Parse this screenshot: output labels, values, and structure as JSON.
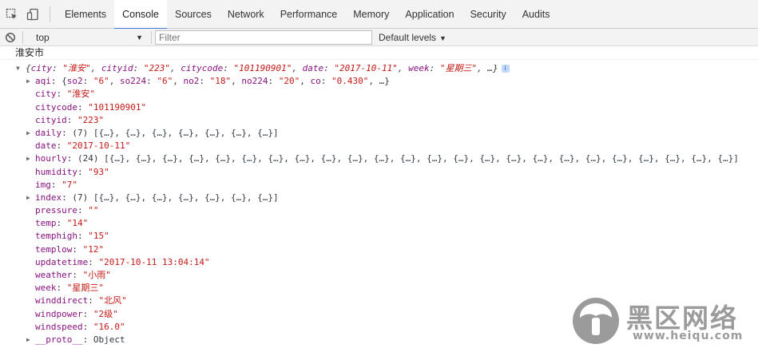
{
  "tabs": [
    "Elements",
    "Console",
    "Sources",
    "Network",
    "Performance",
    "Memory",
    "Application",
    "Security",
    "Audits"
  ],
  "active_tab": "Console",
  "toolbar": {
    "context": "top",
    "filter_placeholder": "Filter",
    "levels": "Default levels"
  },
  "console": {
    "log_text": "淮安市",
    "summary": {
      "open": "{",
      "pairs": [
        {
          "k": "city",
          "v": "\"淮安\""
        },
        {
          "k": "cityid",
          "v": "\"223\""
        },
        {
          "k": "citycode",
          "v": "\"101190901\""
        },
        {
          "k": "date",
          "v": "\"2017-10-11\""
        },
        {
          "k": "week",
          "v": "\"星期三\""
        }
      ],
      "tail": ", …}"
    },
    "aqi": {
      "key": "aqi",
      "open": "{",
      "pairs": [
        {
          "k": "so2",
          "v": "\"6\""
        },
        {
          "k": "so224",
          "v": "\"6\""
        },
        {
          "k": "no2",
          "v": "\"18\""
        },
        {
          "k": "no224",
          "v": "\"20\""
        },
        {
          "k": "co",
          "v": "\"0.430\""
        }
      ],
      "tail": ", …}"
    },
    "props": [
      {
        "key": "city",
        "value": "\"淮安\"",
        "type": "string"
      },
      {
        "key": "citycode",
        "value": "\"101190901\"",
        "type": "string"
      },
      {
        "key": "cityid",
        "value": "\"223\"",
        "type": "string"
      },
      {
        "key": "daily",
        "value": "(7) [{…}, {…}, {…}, {…}, {…}, {…}, {…}]",
        "type": "array"
      },
      {
        "key": "date",
        "value": "\"2017-10-11\"",
        "type": "string"
      },
      {
        "key": "hourly",
        "value": "(24) [{…}, {…}, {…}, {…}, {…}, {…}, {…}, {…}, {…}, {…}, {…}, {…}, {…}, {…}, {…}, {…}, {…}, {…}, {…}, {…}, {…}, {…}, {…}, {…}]",
        "type": "array"
      },
      {
        "key": "humidity",
        "value": "\"93\"",
        "type": "string"
      },
      {
        "key": "img",
        "value": "\"7\"",
        "type": "string"
      },
      {
        "key": "index",
        "value": "(7) [{…}, {…}, {…}, {…}, {…}, {…}, {…}]",
        "type": "array"
      },
      {
        "key": "pressure",
        "value": "\"\"",
        "type": "string"
      },
      {
        "key": "temp",
        "value": "\"14\"",
        "type": "string"
      },
      {
        "key": "temphigh",
        "value": "\"15\"",
        "type": "string"
      },
      {
        "key": "templow",
        "value": "\"12\"",
        "type": "string"
      },
      {
        "key": "updatetime",
        "value": "\"2017-10-11 13:04:14\"",
        "type": "string"
      },
      {
        "key": "weather",
        "value": "\"小雨\"",
        "type": "string"
      },
      {
        "key": "week",
        "value": "\"星期三\"",
        "type": "string"
      },
      {
        "key": "winddirect",
        "value": "\"北风\"",
        "type": "string"
      },
      {
        "key": "windpower",
        "value": "\"2级\"",
        "type": "string"
      },
      {
        "key": "windspeed",
        "value": "\"16.0\"",
        "type": "string"
      },
      {
        "key": "__proto__",
        "value": "Object",
        "type": "proto"
      }
    ]
  },
  "watermark": {
    "text": "黑区网络",
    "url": "www.heiqu.com"
  },
  "colors": {
    "key": "#881280",
    "string": "#c41a16",
    "active_tab_underline": "#3879d9",
    "watermark": "#9b9b9b"
  },
  "icons": [
    "inspect-element-icon",
    "device-toggle-icon",
    "clear-console-icon",
    "dropdown-arrow-icon",
    "expand-triangle-icon",
    "info-icon",
    "watermark-logo-icon"
  ]
}
